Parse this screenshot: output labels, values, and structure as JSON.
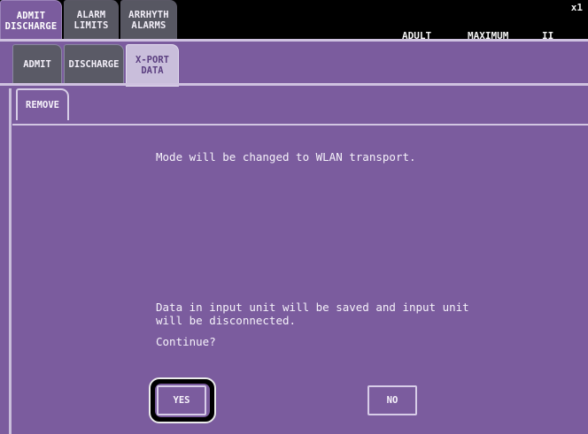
{
  "top_tabs": [
    {
      "line1": "ADMIT",
      "line2": "DISCHARGE"
    },
    {
      "line1": "ALARM",
      "line2": "LIMITS"
    },
    {
      "line1": "ARRHYTH",
      "line2": "ALARMS"
    }
  ],
  "status": {
    "adult": "ADULT",
    "maximum": "MAXIMUM",
    "lead": "II",
    "corner": "x1"
  },
  "sub_tabs": [
    {
      "line1": "ADMIT",
      "line2": ""
    },
    {
      "line1": "DISCHARGE",
      "line2": ""
    },
    {
      "line1": "X-PORT",
      "line2": "DATA"
    }
  ],
  "panel_tab": "REMOVE",
  "dialog": {
    "message1": "Mode will be changed to WLAN transport.",
    "message2": "Data in input unit will be saved and input unit\nwill be disconnected.",
    "question": "Continue?",
    "yes_label": "YES",
    "no_label": "NO"
  },
  "colors": {
    "purple": "#7b5c9e",
    "lavender": "#cfc2e0",
    "inactive_tab": "#575762"
  }
}
